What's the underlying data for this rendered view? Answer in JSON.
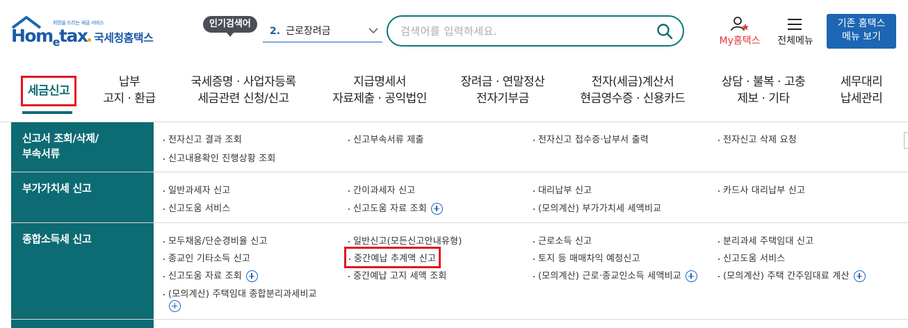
{
  "header": {
    "logo_small": "희망을 드리는 세금 서비스",
    "logo_word_1": "Hom",
    "logo_word_e": "e",
    "logo_word_2": "tax",
    "logo_kr": "국세청홈택스",
    "popular_badge": "인기검색어",
    "popular_selected_num": "2.",
    "popular_selected_text": "근로장려금",
    "search_placeholder": "검색어를 입력하세요.",
    "my_hometax": "My홈택스",
    "all_menu": "전체메뉴",
    "legacy_line1": "기존 홈택스",
    "legacy_line2": "메뉴 보기"
  },
  "nav": {
    "items": [
      {
        "line1": "세금신고",
        "line2": ""
      },
      {
        "line1": "납부",
        "line2": "고지 · 환급"
      },
      {
        "line1": "국세증명 · 사업자등록",
        "line2": "세금관련 신청/신고"
      },
      {
        "line1": "지급명세서",
        "line2": "자료제출 · 공익법인"
      },
      {
        "line1": "장려금 · 연말정산",
        "line2": "전자기부금"
      },
      {
        "line1": "전자(세금)계산서",
        "line2": "현금영수증 · 신용카드"
      },
      {
        "line1": "상담 · 불복 · 고충",
        "line2": "제보 · 기타"
      },
      {
        "line1": "세무대리",
        "line2": "납세관리"
      }
    ]
  },
  "submenu": {
    "rows": [
      {
        "head_line1": "신고서 조회/삭제/",
        "head_line2": "부속서류",
        "links": [
          "전자신고 결과 조회",
          "신고부속서류 제출",
          "전자신고 접수증·납부서 출력",
          "전자신고 삭제 요청",
          "신고내용확인 진행상황 조회"
        ]
      },
      {
        "head_line1": "부가가치세 신고",
        "links": [
          "일반과세자 신고",
          "간이과세자 신고",
          "대리납부 신고",
          "카드사 대리납부 신고",
          "신고도움 서비스",
          "신고도움 자료 조회",
          "(모의계산) 부가가치세 세액비교"
        ]
      },
      {
        "head_line1": "종합소득세 신고",
        "links": [
          "모두채움/단순경비율 신고",
          "일반신고(모든신고안내유형)",
          "근로소득 신고",
          "분리과세 주택임대 신고",
          "종교인 기타소득 신고",
          "중간예납 추계액 신고",
          "토지 등 매매차익 예정신고",
          "신고도움 서비스",
          "신고도움 자료 조회",
          "중간예납 고지 세액 조회",
          "(모의계산) 근로·종교인소득 세액비교",
          "(모의계산) 주택 간주임대료 계산",
          "(모의계산) 주택임대 종합분리과세비교"
        ]
      }
    ]
  },
  "colors": {
    "brand_blue": "#1c66b3",
    "teal": "#0d6b73",
    "highlight_red": "#e2141f",
    "my_red": "#e0353b"
  }
}
